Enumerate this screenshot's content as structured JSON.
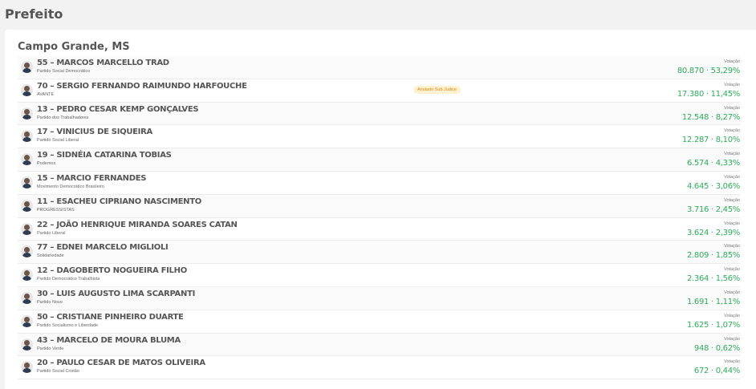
{
  "page_title": "Prefeito",
  "city": "Campo Grande, MS",
  "vote_label": "Votação",
  "badge_label": "Anulado Sub Judice",
  "candidates": [
    {
      "name": "55 – MARCOS MARCELLO TRAD",
      "party": "Partido Social Democrático",
      "votes": "80.870 · 53,29%",
      "badge": ""
    },
    {
      "name": "70 – SERGIO FERNANDO RAIMUNDO HARFOUCHE",
      "party": "AVANTE",
      "votes": "17.380 · 11,45%",
      "badge": "Anulado Sub Judice"
    },
    {
      "name": "13 – PEDRO CESAR KEMP GONÇALVES",
      "party": "Partido dos Trabalhadores",
      "votes": "12.548 · 8,27%",
      "badge": ""
    },
    {
      "name": "17 – VINICIUS DE SIQUEIRA",
      "party": "Partido Social Liberal",
      "votes": "12.287 · 8,10%",
      "badge": ""
    },
    {
      "name": "19 – SIDNÉIA CATARINA TOBIAS",
      "party": "Podemos",
      "votes": "6.574 · 4,33%",
      "badge": ""
    },
    {
      "name": "15 – MARCIO FERNANDES",
      "party": "Movimento Democrático Brasileiro",
      "votes": "4.645 · 3,06%",
      "badge": ""
    },
    {
      "name": "11 – ESACHEU CIPRIANO NASCIMENTO",
      "party": "PROGRESSISTAS",
      "votes": "3.716 · 2,45%",
      "badge": ""
    },
    {
      "name": "22 – JOÃO HENRIQUE MIRANDA SOARES CATAN",
      "party": "Partido Liberal",
      "votes": "3.624 · 2,39%",
      "badge": ""
    },
    {
      "name": "77 – EDNEI MARCELO MIGLIOLI",
      "party": "Solidariedade",
      "votes": "2.809 · 1,85%",
      "badge": ""
    },
    {
      "name": "12 – DAGOBERTO NOGUEIRA FILHO",
      "party": "Partido Democrático Trabalhista",
      "votes": "2.364 · 1,56%",
      "badge": ""
    },
    {
      "name": "30 – LUIS AUGUSTO LIMA SCARPANTI",
      "party": "Partido Novo",
      "votes": "1.691 · 1,11%",
      "badge": ""
    },
    {
      "name": "50 – CRISTIANE PINHEIRO DUARTE",
      "party": "Partido Socialismo e Liberdade",
      "votes": "1.625 · 1,07%",
      "badge": ""
    },
    {
      "name": "43 – MARCELO DE MOURA BLUMA",
      "party": "Partido Verde",
      "votes": "948 · 0,62%",
      "badge": ""
    },
    {
      "name": "20 – PAULO CESAR DE MATOS OLIVEIRA",
      "party": "Partido Social Cristão",
      "votes": "672 · 0,44%",
      "badge": ""
    }
  ]
}
